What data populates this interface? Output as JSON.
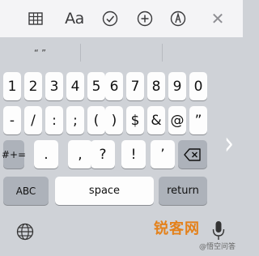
{
  "toolbar": {
    "format_label": "Aa",
    "close_label": "✕"
  },
  "suggestions": [
    "“ ”",
    "",
    ""
  ],
  "keyboard": {
    "row1": [
      "1",
      "2",
      "3",
      "4",
      "5",
      "6",
      "7",
      "8",
      "9",
      "0"
    ],
    "row2": [
      "-",
      "/",
      ":",
      ";",
      "(",
      ")",
      "$",
      "&",
      "@",
      "”"
    ],
    "row3": [
      ".",
      ",",
      "?",
      "!",
      "’"
    ],
    "symbols_key": "#+=",
    "abc_key": "ABC",
    "space_key": "space",
    "return_key": "return",
    "next_chevron": "›"
  },
  "watermark": {
    "logo_text": "锐客网",
    "sub_text": "@悟空问答"
  }
}
